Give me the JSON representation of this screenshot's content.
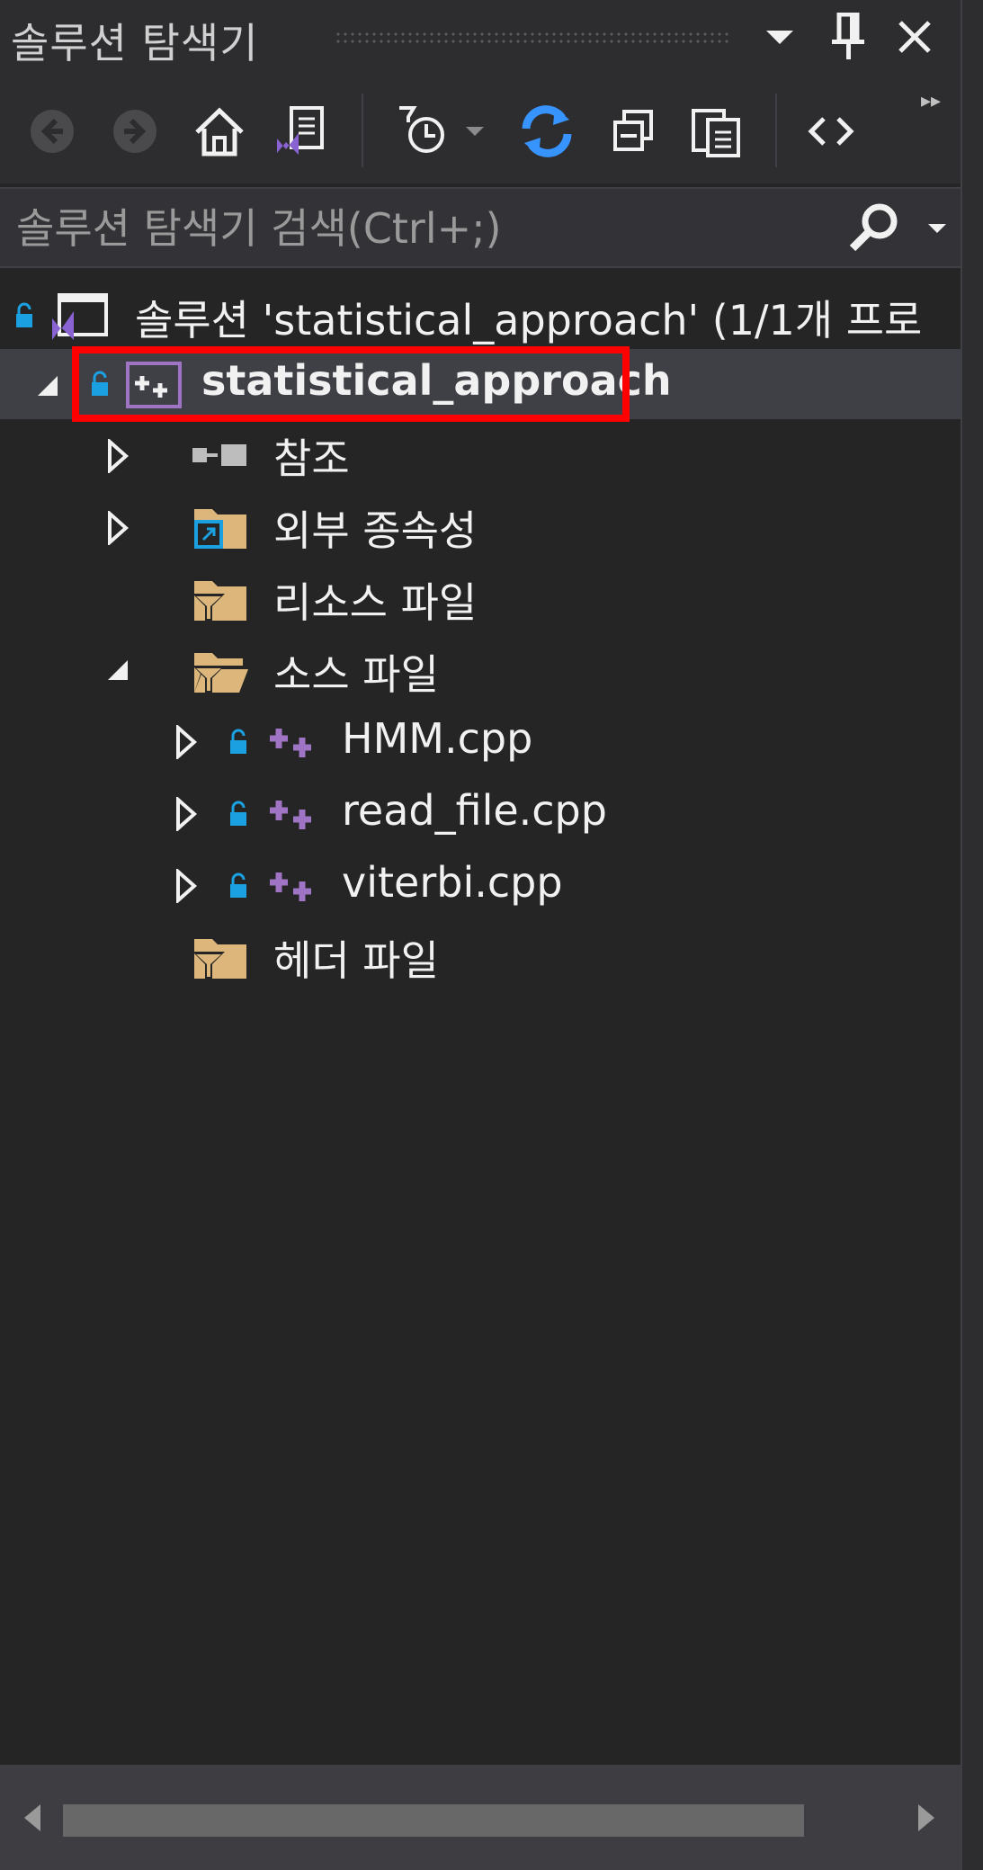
{
  "panel": {
    "title": "솔루션 탐색기",
    "title_buttons": [
      "dropdown-icon",
      "pin-icon",
      "close-icon"
    ]
  },
  "toolbar": {
    "tools": [
      "back-icon",
      "forward-icon",
      "home-icon",
      "switch-views-icon",
      "pending-changes-filter-icon",
      "sync-icon",
      "collapse-all-icon",
      "show-all-files-icon",
      "code-view-icon"
    ],
    "overflow": "▸▸"
  },
  "search": {
    "placeholder": "솔루션 탐색기 검색(Ctrl+;)",
    "value": ""
  },
  "tree": {
    "solution": {
      "label": "솔루션 'statistical_approach' (1/1개 프로"
    },
    "project": {
      "label": "statistical_approach",
      "selected": true
    },
    "nodes": [
      {
        "label": "참조",
        "icon": "references-icon"
      },
      {
        "label": "외부 종속성",
        "icon": "external-deps-icon"
      },
      {
        "label": "리소스 파일",
        "icon": "filter-folder-icon"
      },
      {
        "label": "소스 파일",
        "icon": "filter-folder-open-icon"
      },
      {
        "label": "HMM.cpp",
        "icon": "cpp-file-icon"
      },
      {
        "label": "read_file.cpp",
        "icon": "cpp-file-icon"
      },
      {
        "label": "viterbi.cpp",
        "icon": "cpp-file-icon"
      },
      {
        "label": "헤더 파일",
        "icon": "filter-folder-icon"
      }
    ]
  },
  "colors": {
    "background": "#252526",
    "selection": "#3f3f46",
    "highlight_border": "#ff0000",
    "folder": "#dcb67a",
    "cpp": "#a074c4",
    "lock": "#1ba1e2",
    "sync": "#3794ff"
  }
}
